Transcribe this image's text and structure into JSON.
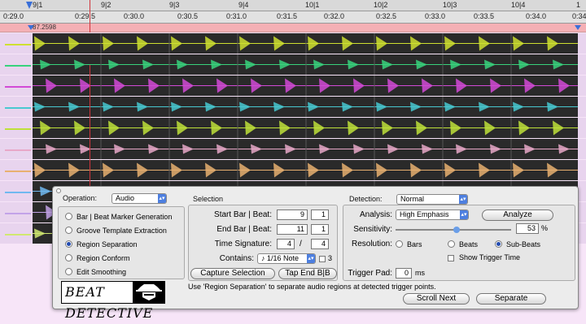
{
  "ruler": {
    "bars": [
      "9|1",
      "9|2",
      "9|3",
      "9|4",
      "10|1",
      "10|2",
      "10|3",
      "10|4",
      "1"
    ],
    "times": [
      "0:29.0",
      "0:29.5",
      "0:30.0",
      "0:30.5",
      "0:31.0",
      "0:31.5",
      "0:32.0",
      "0:32.5",
      "0:33.0",
      "0:33.5",
      "0:34.0",
      "0:34."
    ],
    "tempo": "87.2598"
  },
  "tracks": {
    "colors": [
      "#cfe030",
      "#38d27c",
      "#d24ad6",
      "#48c8d0",
      "#bee03a",
      "#e8a8c8",
      "#e8b070",
      "#70b8f0",
      "#c3a3e8",
      "#d0e870"
    ]
  },
  "dialog": {
    "operation_label": "Operation:",
    "operation_value": "Audio",
    "operations": [
      {
        "label": "Bar | Beat Marker Generation",
        "selected": false
      },
      {
        "label": "Groove Template Extraction",
        "selected": false
      },
      {
        "label": "Region Separation",
        "selected": true
      },
      {
        "label": "Region Conform",
        "selected": false
      },
      {
        "label": "Edit Smoothing",
        "selected": false
      }
    ],
    "selection_label": "Selection",
    "start_label": "Start Bar | Beat:",
    "start_bar": "9",
    "start_beat": "1",
    "end_label": "End Bar | Beat:",
    "end_bar": "11",
    "end_beat": "1",
    "ts_label": "Time Signature:",
    "ts_num": "4",
    "ts_slash": "/",
    "ts_den": "4",
    "contains_label": "Contains:",
    "contains_value": "♪ 1/16 Note",
    "contains_check_label": "3",
    "capture_button": "Capture Selection",
    "tap_end_button": "Tap End B|B",
    "detection_label": "Detection:",
    "detection_value": "Normal",
    "analysis_label": "Analysis:",
    "analysis_value": "High Emphasis",
    "analyze_button": "Analyze",
    "sensitivity_label": "Sensitivity:",
    "sensitivity_value": "53",
    "sensitivity_unit": "%",
    "resolution_label": "Resolution:",
    "resolutions": [
      {
        "label": "Bars",
        "selected": false
      },
      {
        "label": "Beats",
        "selected": false
      },
      {
        "label": "Sub-Beats",
        "selected": true
      }
    ],
    "show_trigger_label": "Show Trigger Time",
    "trigger_pad_label": "Trigger Pad:",
    "trigger_pad_value": "0",
    "trigger_pad_unit": "ms",
    "logo_text": "BEAT DETECTIVE",
    "hint": "Use 'Region Separation' to separate audio regions at detected trigger points.",
    "scroll_next_button": "Scroll Next",
    "separate_button": "Separate"
  }
}
